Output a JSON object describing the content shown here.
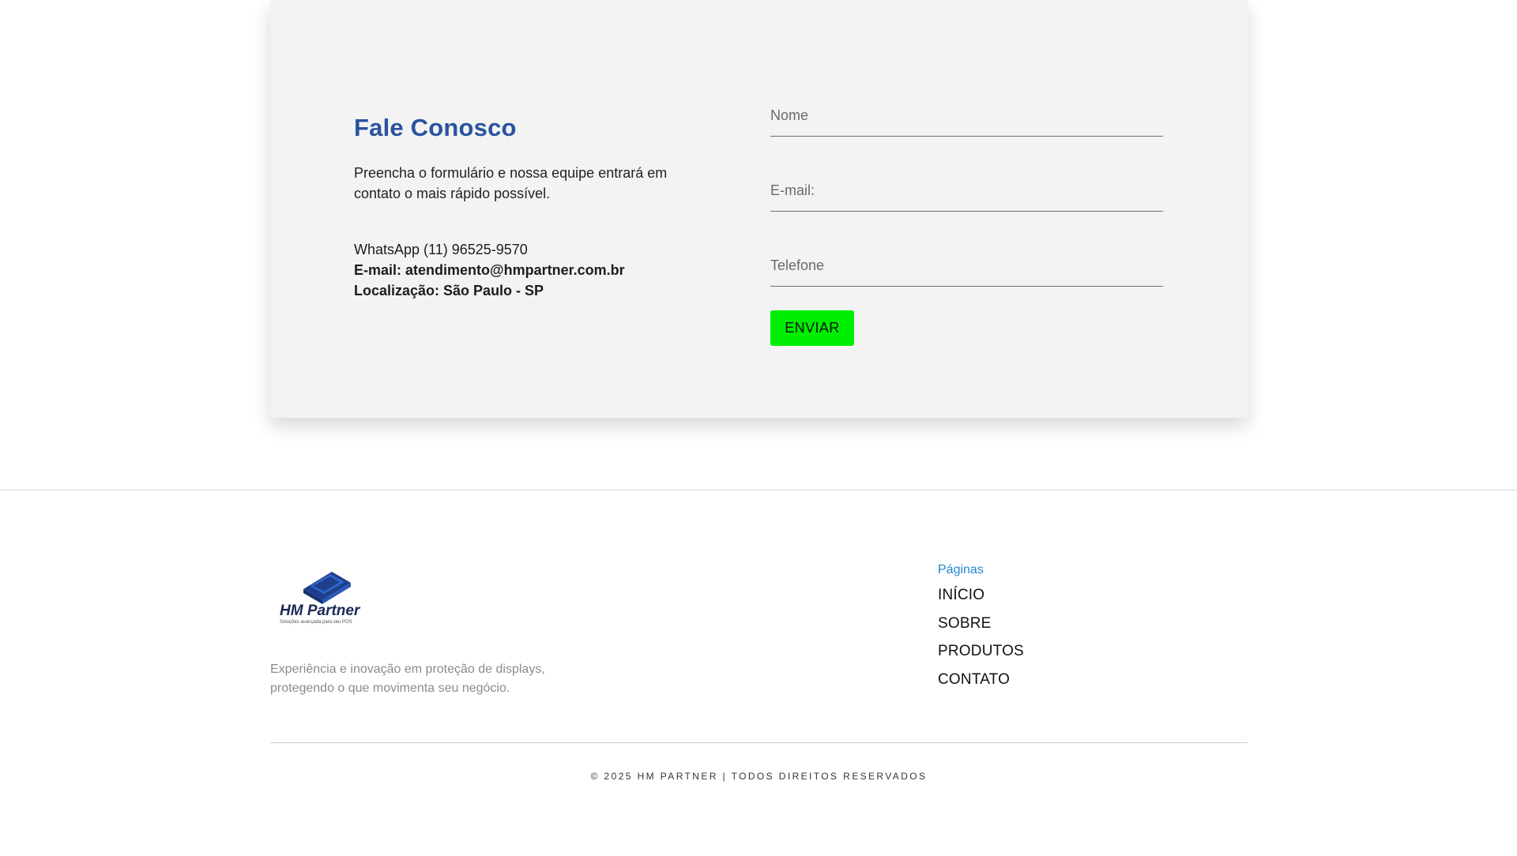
{
  "contact": {
    "title": "Fale Conosco",
    "description": "Preencha o formulário e nossa equipe entrará em contato o mais rápido possível.",
    "whatsapp": "WhatsApp (11) 96525-9570",
    "email": "E-mail: atendimento@hmpartner.com.br",
    "location": "Localização: São Paulo - SP"
  },
  "form": {
    "name_placeholder": "Nome",
    "email_placeholder": "E-mail:",
    "phone_placeholder": "Telefone",
    "submit_label": "ENVIAR",
    "submit_color": "#00ee00"
  },
  "footer": {
    "logo": {
      "brand": "HM Partner",
      "tagline": "Soluções avançada para seu POS",
      "icon": "stacked-display-icon",
      "color": "#1f3f8c"
    },
    "description": "Experiência e inovação em proteção de displays, protegendo o que movimenta seu negócio.",
    "nav_title": "Páginas",
    "nav_links": [
      "INÍCIO",
      "SOBRE",
      "PRODUTOS",
      "CONTATO"
    ],
    "copyright": "© 2025 HM PARTNER | TODOS DIREITOS RESERVADOS"
  },
  "colors": {
    "title_blue": "#2a52a0",
    "link_blue": "#1f86d0",
    "card_bg": "#f3f3f3"
  }
}
